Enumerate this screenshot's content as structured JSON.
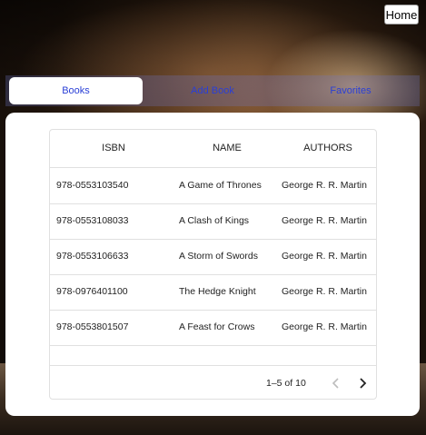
{
  "header": {
    "home_label": "Home"
  },
  "tabs": [
    {
      "label": "Books",
      "active": true
    },
    {
      "label": "Add Book",
      "active": false
    },
    {
      "label": "Favorites",
      "active": false
    }
  ],
  "table": {
    "columns": [
      "ISBN",
      "NAME",
      "AUTHORS"
    ],
    "rows": [
      {
        "isbn": "978-0553103540",
        "name": "A Game of Thrones",
        "authors": "George R. R. Martin"
      },
      {
        "isbn": "978-0553108033",
        "name": "A Clash of Kings",
        "authors": "George R. R. Martin"
      },
      {
        "isbn": "978-0553106633",
        "name": "A Storm of Swords",
        "authors": "George R. R. Martin"
      },
      {
        "isbn": "978-0976401100",
        "name": "The Hedge Knight",
        "authors": "George R. R. Martin"
      },
      {
        "isbn": "978-0553801507",
        "name": "A Feast for Crows",
        "authors": "George R. R. Martin"
      }
    ]
  },
  "pagination": {
    "range_text": "1–5 of 10",
    "prev_icon": "chevron-left-icon",
    "next_icon": "chevron-right-icon"
  },
  "colors": {
    "tab_text": "#2a3fd6",
    "tab_bar": "#6e78c8"
  }
}
